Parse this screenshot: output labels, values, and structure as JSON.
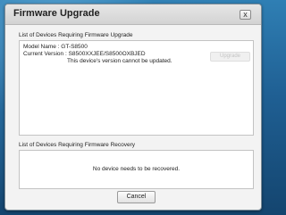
{
  "dialog": {
    "title": "Firmware Upgrade",
    "close_label": "x"
  },
  "upgrade_section": {
    "label": "List of Devices Requiring Firmware Upgrade",
    "device": {
      "model_line": "Model Name : GT-S8500",
      "version_line": "Current Version : S8500XXJEE/S8500OXBJED",
      "status_line": "This device's version cannot be updated."
    },
    "upgrade_button_label": "Upgrade"
  },
  "recovery_section": {
    "label": "List of Devices Requiring Firmware Recovery",
    "empty_message": "No device needs to be recovered."
  },
  "footer": {
    "cancel_label": "Cancel"
  }
}
